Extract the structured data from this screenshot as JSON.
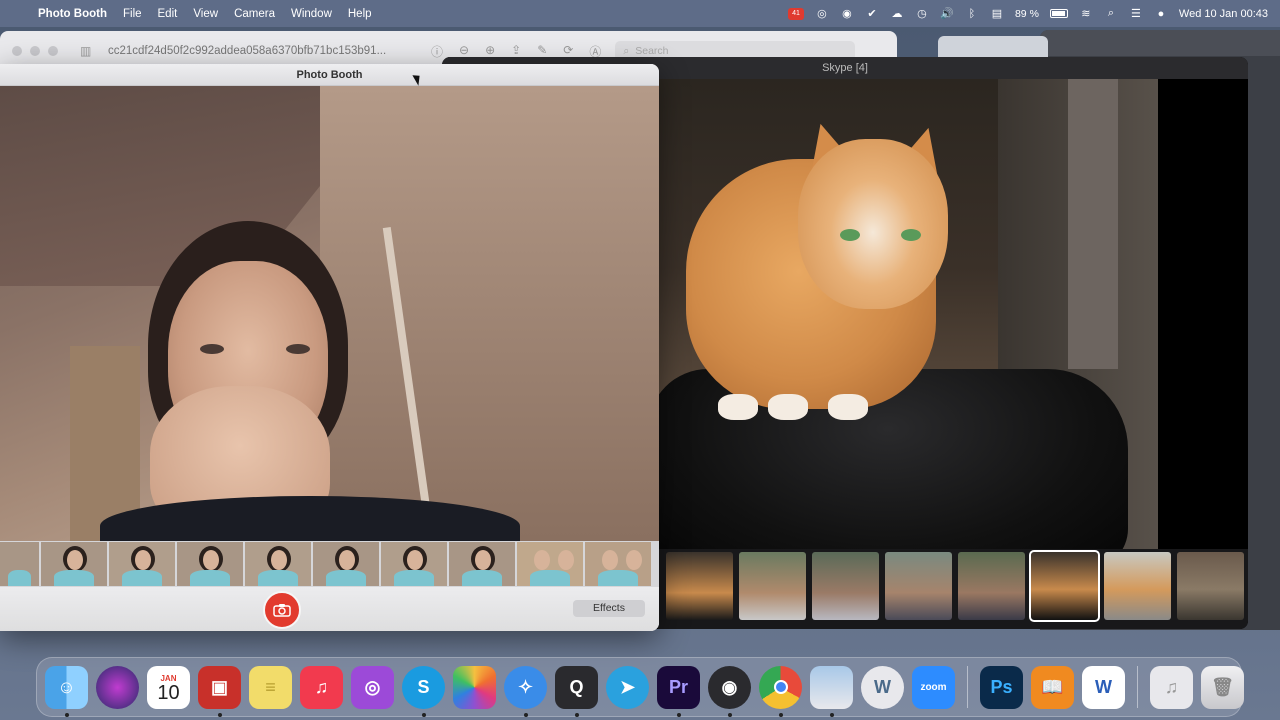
{
  "menubar": {
    "app_name": "Photo Booth",
    "items": [
      "File",
      "Edit",
      "View",
      "Camera",
      "Window",
      "Help"
    ],
    "badge_count": "41",
    "battery_percent": "89 %",
    "datetime": "Wed 10 Jan  00:43"
  },
  "preview": {
    "title": "cc21cdf24d50f2c992addea058a6370bfb71bc153b91...",
    "search_placeholder": "Search"
  },
  "skype": {
    "title": "Skype [4]"
  },
  "photo_booth": {
    "title": "Photo Booth",
    "effects_label": "Effects"
  },
  "dock": {
    "calendar_month": "JAN",
    "calendar_day": "10",
    "apps": [
      "Finder",
      "Siri",
      "Calendar",
      "Photo Booth",
      "Stickies",
      "Music",
      "Podcasts",
      "Skype",
      "Photos",
      "Safari",
      "QuickTime Player",
      "Telegram",
      "Premiere Pro",
      "OBS",
      "Chrome",
      "Preview",
      "WordPress",
      "Zoom",
      "Photoshop",
      "Books",
      "Word",
      "Music Document",
      "Trash"
    ]
  },
  "colors": {
    "shutter": "#e23b2e",
    "menubar": "#606e8a"
  }
}
